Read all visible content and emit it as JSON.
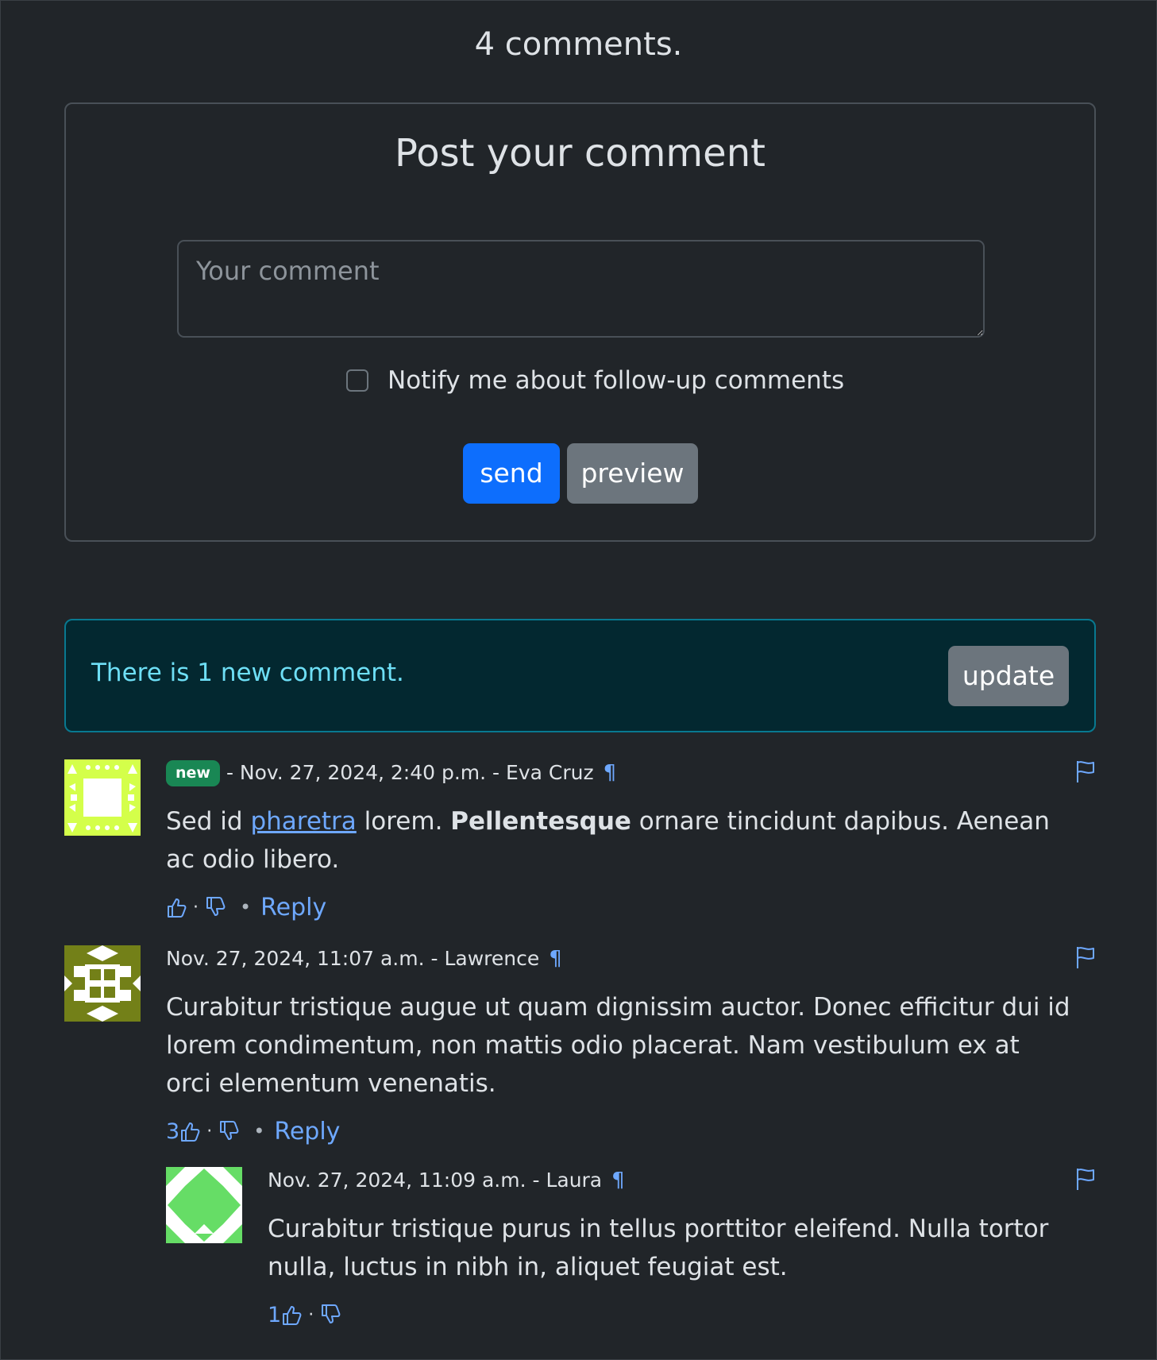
{
  "header": {
    "count_text": "4 comments."
  },
  "form": {
    "title": "Post your comment",
    "comment_placeholder": "Your comment",
    "notify_label": "Notify me about follow-up comments",
    "send_label": "send",
    "preview_label": "preview"
  },
  "alert": {
    "message": "There is 1 new comment.",
    "update_label": "update"
  },
  "comments": [
    {
      "badge": "new",
      "meta": "- Nov. 27, 2024, 2:40 p.m. - Eva Cruz",
      "text_before": "Sed id ",
      "link": "pharetra",
      "text_mid": " lorem. ",
      "bold": "Pellentesque",
      "text_after": " ornare tincidunt dapibus. Aenean ac odio libero.",
      "likes": "",
      "reply_label": "Reply",
      "pilcrow": "¶",
      "avatar_color": "#d4ff4a"
    },
    {
      "meta": "Nov. 27, 2024, 11:07 a.m. - Lawrence",
      "text": "Curabitur tristique augue ut quam dignissim auctor. Donec efficitur dui id lorem condimentum, non mattis odio placerat. Nam vestibulum ex at orci elementum venenatis.",
      "likes": "3",
      "reply_label": "Reply",
      "pilcrow": "¶",
      "avatar_color": "#738018"
    },
    {
      "meta": "Nov. 27, 2024, 11:09 a.m. - Laura",
      "text": "Curabitur tristique purus in tellus porttitor eleifend. Nulla tortor nulla, luctus in nibh in, aliquet feugiat est.",
      "likes": "1",
      "pilcrow": "¶",
      "avatar_color": "#66dd66"
    }
  ],
  "separators": {
    "dot": "·",
    "bullet": "•"
  }
}
